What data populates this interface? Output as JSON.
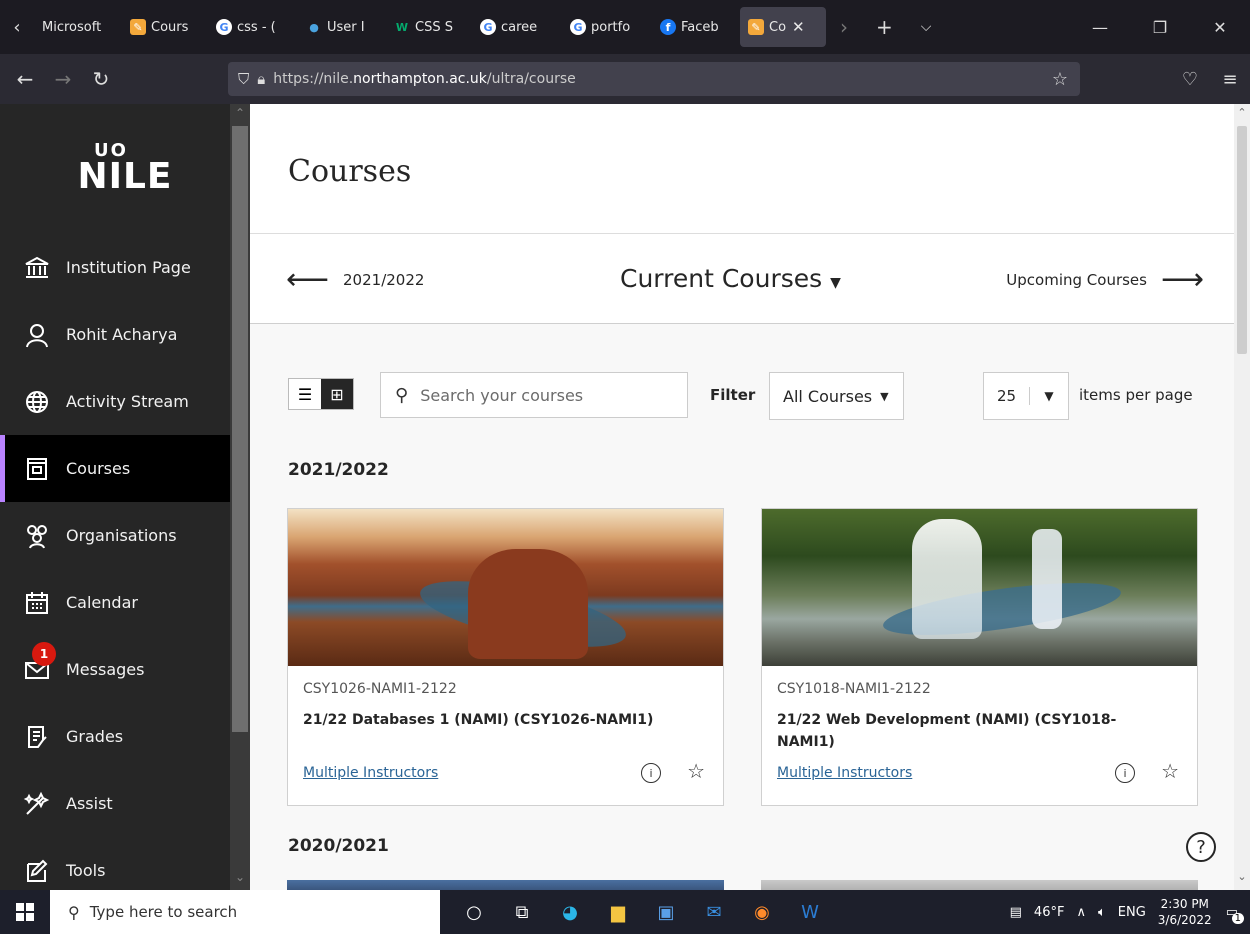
{
  "browser": {
    "tabs": [
      {
        "label": "Microsoft",
        "icon": "microsoft-icon",
        "color": "#f25022"
      },
      {
        "label": "Cours",
        "icon": "course-icon",
        "color": "#f3a83b"
      },
      {
        "label": "css - (",
        "icon": "google-icon",
        "color": "#4285f4"
      },
      {
        "label": "User I",
        "icon": "user-icon",
        "color": "#4aa3df"
      },
      {
        "label": "CSS S",
        "icon": "w3-icon",
        "color": "#04aa6d"
      },
      {
        "label": "caree",
        "icon": "google-icon",
        "color": "#4285f4"
      },
      {
        "label": "portfo",
        "icon": "google-icon",
        "color": "#4285f4"
      },
      {
        "label": "Faceb",
        "icon": "facebook-icon",
        "color": "#1877f2"
      },
      {
        "label": "Co",
        "icon": "course-icon",
        "color": "#f3a83b"
      }
    ],
    "url_prefix": "https://nile.",
    "url_host": "northampton.ac.uk",
    "url_path": "/ultra/course"
  },
  "sidebar": {
    "logo_top": "UO",
    "logo_main": "NILE",
    "items": [
      {
        "label": "Institution Page",
        "icon": "institution-icon"
      },
      {
        "label": "Rohit Acharya",
        "icon": "profile-icon"
      },
      {
        "label": "Activity Stream",
        "icon": "globe-icon"
      },
      {
        "label": "Courses",
        "icon": "courses-icon"
      },
      {
        "label": "Organisations",
        "icon": "organisations-icon"
      },
      {
        "label": "Calendar",
        "icon": "calendar-icon"
      },
      {
        "label": "Messages",
        "icon": "messages-icon"
      },
      {
        "label": "Grades",
        "icon": "grades-icon"
      },
      {
        "label": "Assist",
        "icon": "assist-icon"
      },
      {
        "label": "Tools",
        "icon": "tools-icon"
      }
    ],
    "messages_badge": "1"
  },
  "main": {
    "title": "Courses",
    "term_prev": "2021/2022",
    "term_current": "Current Courses",
    "term_next": "Upcoming Courses",
    "search_placeholder": "Search your courses",
    "filter_label": "Filter",
    "filter_value": "All Courses",
    "per_page_value": "25",
    "per_page_label": "items per page",
    "sections": [
      {
        "term": "2021/2022",
        "courses": [
          {
            "code": "CSY1026-NAMI1-2122",
            "title": "21/22 Databases 1 (NAMI) (CSY1026-NAMI1)",
            "instructors": "Multiple Instructors"
          },
          {
            "code": "CSY1018-NAMI1-2122",
            "title": "21/22 Web Development (NAMI) (CSY1018-NAMI1)",
            "instructors": "Multiple Instructors"
          }
        ]
      },
      {
        "term": "2020/2021",
        "courses": []
      }
    ]
  },
  "taskbar": {
    "search_placeholder": "Type here to search",
    "weather": "46°F",
    "language": "ENG",
    "time": "2:30 PM",
    "date": "3/6/2022",
    "notifications": "1"
  }
}
